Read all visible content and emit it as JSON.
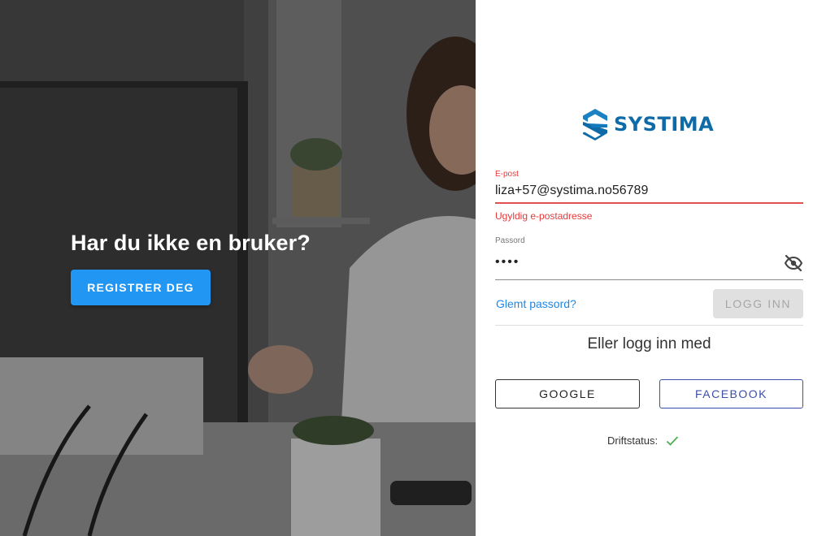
{
  "hero": {
    "title": "Har du ikke en bruker?",
    "register_label": "REGISTRER DEG"
  },
  "brand": {
    "name": "SYSTIMA",
    "color": "#0f6ba8"
  },
  "login": {
    "email_label": "E-post",
    "email_value": "liza+57@systima.no56789",
    "email_error": "Ugyldig e-postadresse",
    "password_label": "Passord",
    "password_value": "••••",
    "forgot_label": "Glemt passord?",
    "login_label": "LOGG INN",
    "or_label": "Eller logg inn med",
    "google_label": "GOOGLE",
    "facebook_label": "FACEBOOK",
    "status_label": "Driftstatus:"
  },
  "icons": {
    "password_toggle": "eye-off-icon",
    "status": "check-icon"
  },
  "colors": {
    "register": "#2196f3",
    "error": "#e5393a",
    "link": "#1e88e5",
    "facebook": "#3b4fa8",
    "status_ok": "#4caf50"
  }
}
